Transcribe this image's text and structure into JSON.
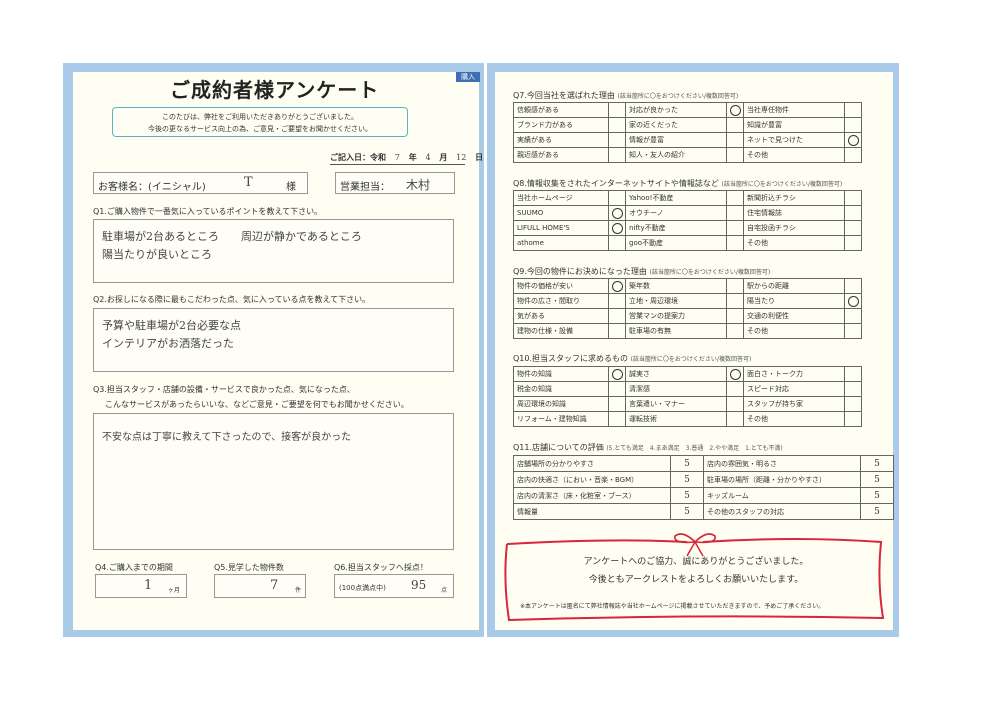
{
  "left": {
    "title": "ご成約者様アンケート",
    "tag": "購入",
    "intro_line1": "このたびは、弊社をご利用いただきありがとうございました。",
    "intro_line2": "今後の更なるサービス向上の為、ご意見・ご要望をお聞かせください。",
    "date_label": "ご記入日：令和",
    "date_year": "7",
    "date_year_unit": "年",
    "date_month": "4",
    "date_month_unit": "月",
    "date_day": "12",
    "date_day_unit": "日",
    "customer_label": "お客様名：(イニシャル)",
    "customer_value": "T",
    "customer_suffix": "様",
    "staff_label": "営業担当：",
    "staff_value": "木村",
    "q1": "Q1.ご購入物件で一番気に入っているポイントを教えて下さい。",
    "q1_answer_line1": "駐車場が2台あるところ　　周辺が静かであるところ",
    "q1_answer_line2": "陽当たりが良いところ",
    "q2": "Q2.お探しになる際に最もこだわった点、気に入っている点を教えて下さい。",
    "q2_answer_line1": "予算や駐車場が2台必要な点",
    "q2_answer_line2": "インテリアがお洒落だった",
    "q3_line1": "Q3.担当スタッフ・店舗の設備・サービスで良かった点、気になった点、",
    "q3_line2": "こんなサービスがあったらいいな、などご意見・ご要望を何でもお聞かせください。",
    "q3_answer": "不安な点は丁寧に教えて下さったので、接客が良かった",
    "q4_label": "Q4.ご購入までの期間",
    "q4_value": "1",
    "q4_unit": "ヶ月",
    "q5_label": "Q5.見学した物件数",
    "q5_value": "7",
    "q5_unit": "件",
    "q6_label": "Q6.担当スタッフへ採点！",
    "q6_hint": "(100点満点中)",
    "q6_value": "95",
    "q6_unit": "点"
  },
  "right": {
    "q7": "Q7.今回当社を選ばれた理由",
    "q7_note": "(該当箇所に〇をおつけください/複数回答可)",
    "q7_rows": [
      [
        "信頼感がある",
        "対応が良かった",
        "当社専任物件"
      ],
      [
        "ブランド力がある",
        "家の近くだった",
        "知識が豊富"
      ],
      [
        "実績がある",
        "情報が豊富",
        "ネットで見つけた"
      ],
      [
        "親近感がある",
        "知人・友人の紹介",
        "その他"
      ]
    ],
    "q8": "Q8.情報収集をされたインターネットサイトや情報誌など",
    "q8_note": "(該当箇所に〇をおつけください/複数回答可)",
    "q8_rows": [
      [
        "当社ホームページ",
        "Yahoo!不動産",
        "新聞折込チラシ"
      ],
      [
        "SUUMO",
        "オウチーノ",
        "住宅情報誌"
      ],
      [
        "LIFULL HOME'S",
        "nifty不動産",
        "自宅投函チラシ"
      ],
      [
        "athome",
        "goo不動産",
        "その他"
      ]
    ],
    "q9": "Q9.今回の物件にお決めになった理由",
    "q9_note": "(該当箇所に〇をおつけください/複数回答可)",
    "q9_rows": [
      [
        "物件の価格が安い",
        "築年数",
        "駅からの距離"
      ],
      [
        "物件の広さ・間取り",
        "立地・周辺環境",
        "陽当たり"
      ],
      [
        "気がある",
        "営業マンの提案力",
        "交通の利便性"
      ],
      [
        "建物の仕様・設備",
        "駐車場の有無",
        "その他"
      ]
    ],
    "q10": "Q10.担当スタッフに求めるもの",
    "q10_note": "(該当箇所に〇をおつけください/複数回答可)",
    "q10_rows": [
      [
        "物件の知識",
        "誠実さ",
        "面白さ・トーク力"
      ],
      [
        "税金の知識",
        "清潔感",
        "スピード対応"
      ],
      [
        "周辺環境の知識",
        "言葉遣い・マナー",
        "スタッフが持ち家"
      ],
      [
        "リフォーム・建物知識",
        "運転技術",
        "その他"
      ]
    ],
    "q11": "Q11.店舗についての評価",
    "q11_scale": "(5.とても満足　4.まあ満足　3.普通　2.やや満足　1.とても不満)",
    "q11_rows": [
      [
        "店舗場所の分かりやすさ",
        "5",
        "店内の雰囲気・明るさ",
        "5"
      ],
      [
        "店内の快適さ（におい・音楽・BGM）",
        "5",
        "駐車場の場所（距離・分かりやすさ）",
        "5"
      ],
      [
        "店内の清潔さ（床・化粧室・ブース）",
        "5",
        "キッズルーム",
        "5"
      ],
      [
        "情報量",
        "5",
        "その他のスタッフの対応",
        "5"
      ]
    ],
    "thanks_line1": "アンケートへのご協力、誠にありがとうございました。",
    "thanks_line2": "今後ともアークレストをよろしくお願いいたします。",
    "footer_note": "※本アンケートは匿名にて弊社情報誌や当社ホームページに掲載させていただきますので、予めご了承ください。"
  },
  "colors": {
    "frame": "#a9cbe9",
    "ribbon": "#d8263a",
    "intro_border": "#5db3c4",
    "tag": "#3d6fb4"
  }
}
